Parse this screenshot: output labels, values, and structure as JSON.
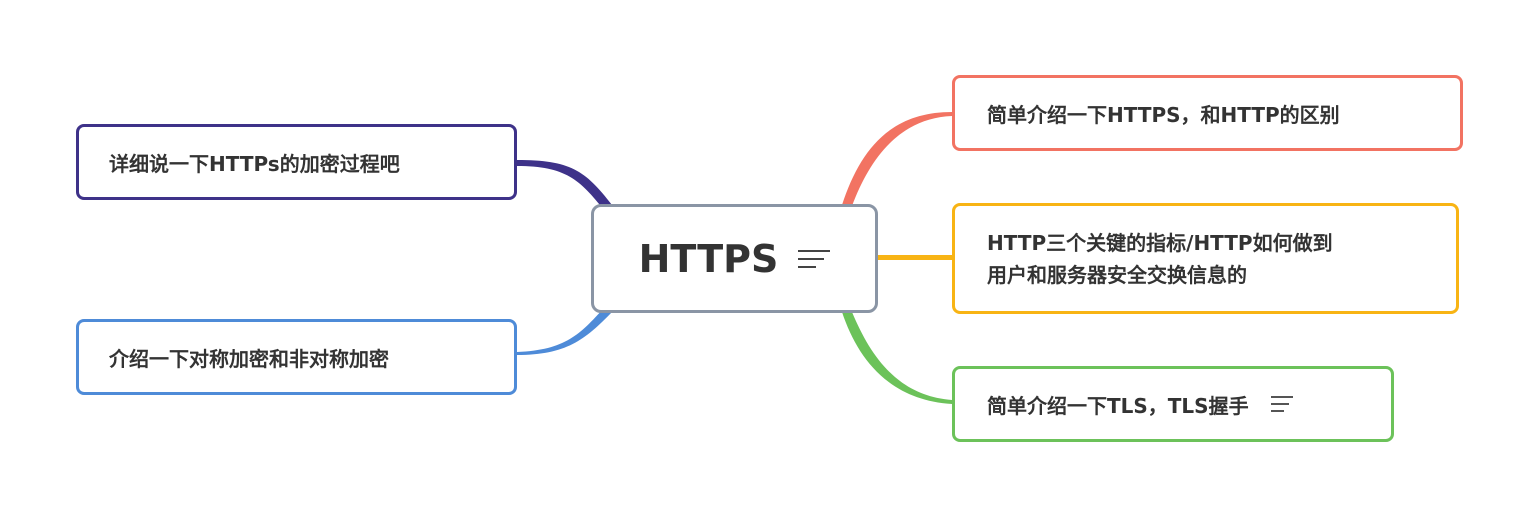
{
  "center": {
    "label": "HTTPS",
    "notes_icon": "notes-icon"
  },
  "branches": {
    "left": [
      {
        "label": "详细说一下HTTPs的加密过程吧",
        "color": "#3e3289"
      },
      {
        "label": "介绍一下对称加密和非对称加密",
        "color": "#4e8bd8"
      }
    ],
    "right": [
      {
        "label": "简单介绍一下HTTPS，和HTTP的区别",
        "color": "#f27362"
      },
      {
        "label_line1": "HTTP三个关键的指标/HTTP如何做到",
        "label_line2": "用户和服务器安全交换信息的",
        "color": "#f8b414"
      },
      {
        "label": "简单介绍一下TLS，TLS握手",
        "color": "#6cc25a",
        "notes_icon": "notes-icon"
      }
    ]
  }
}
